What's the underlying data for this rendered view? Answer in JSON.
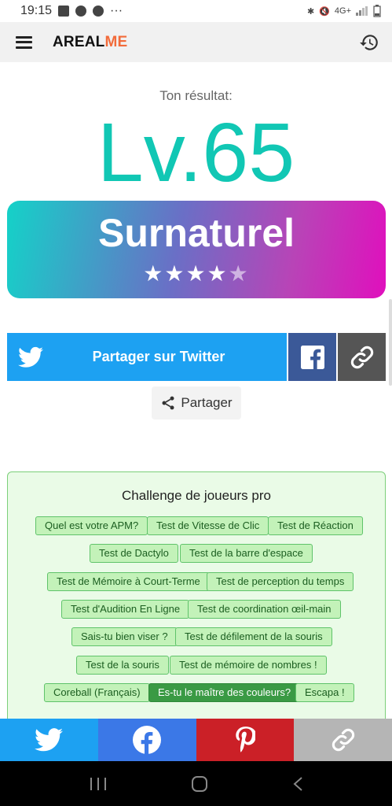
{
  "status_bar": {
    "time": "19:15",
    "more": "···",
    "network": "4G+"
  },
  "header": {
    "logo_part1": "AREAL",
    "logo_part2": "ME"
  },
  "result": {
    "label": "Ton résultat:",
    "level": "Lv.65",
    "rank": "Surnaturel",
    "stars_filled": "★★★★",
    "stars_empty": "★",
    "rating": 4,
    "rating_max": 5
  },
  "share": {
    "twitter_label": "Partager sur Twitter",
    "generic_label": "Partager"
  },
  "challenge": {
    "title": "Challenge de joueurs pro",
    "tags": [
      "Quel est votre APM?",
      "Test de Vitesse de Clic",
      "Test de Réaction",
      "Test de Dactylo",
      "Test de la barre d'espace",
      "Test de Mémoire à Court-Terme",
      "Test de perception du temps",
      "Test d'Audition En Ligne",
      "Test de coordination œil-main",
      "Sais-tu bien viser ?",
      "Test de défilement de la souris",
      "Test de la souris",
      "Test de mémoire de nombres !",
      "Coreball (Français)",
      "Es-tu le maître des couleurs?",
      "Escapa !"
    ]
  },
  "colors": {
    "accent": "#11c7b4",
    "twitter": "#1da1f2",
    "facebook": "#3b5998",
    "pinterest": "#cb2027",
    "logo_accent": "#f26b3a"
  }
}
